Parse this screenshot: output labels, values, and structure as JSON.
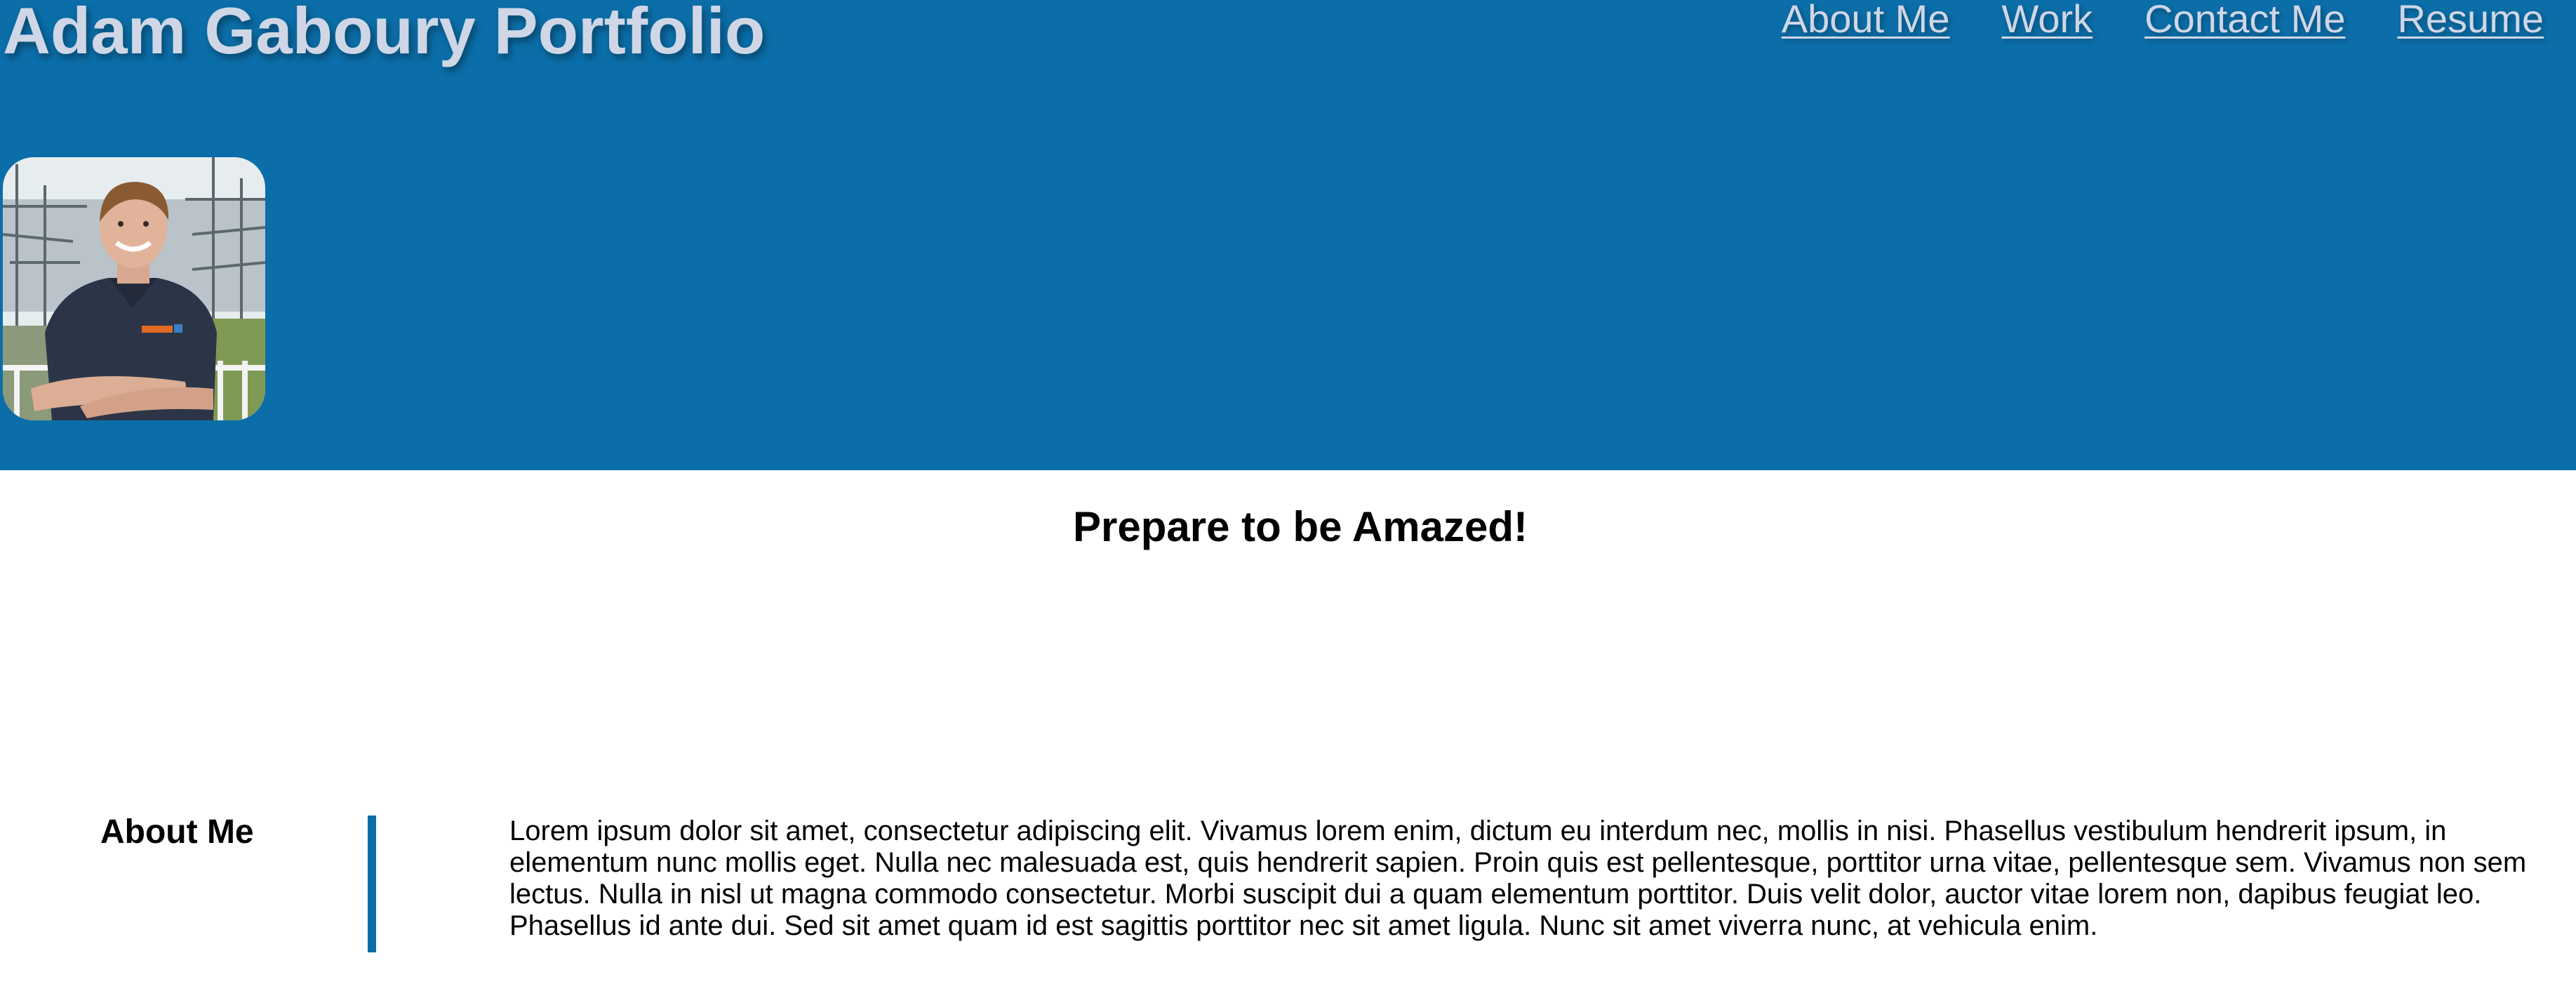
{
  "header": {
    "title": "Adam Gaboury Portfolio",
    "nav": [
      {
        "label": "About Me"
      },
      {
        "label": "Work"
      },
      {
        "label": "Contact Me"
      },
      {
        "label": "Resume"
      }
    ],
    "background_color": "#0b6ea8",
    "text_color": "#cfd6e6"
  },
  "hero": {
    "tagline": "Prepare to be Amazed!"
  },
  "about": {
    "heading": "About Me",
    "body": "Lorem ipsum dolor sit amet, consectetur adipiscing elit. Vivamus lorem enim, dictum eu interdum nec, mollis in nisi. Phasellus vestibulum hendrerit ipsum, in elementum nunc mollis eget. Nulla nec malesuada est, quis hendrerit sapien. Proin quis est pellentesque, porttitor urna vitae, pellentesque sem. Vivamus non sem lectus. Nulla in nisl ut magna commodo consectetur. Morbi suscipit dui a quam elementum porttitor. Duis velit dolor, auctor vitae lorem non, dapibus feugiat leo. Phasellus id ante dui. Sed sit amet quam id est sagittis porttitor nec sit amet ligula. Nunc sit amet viverra nunc, at vehicula enim.",
    "accent_color": "#0b6ea8"
  }
}
